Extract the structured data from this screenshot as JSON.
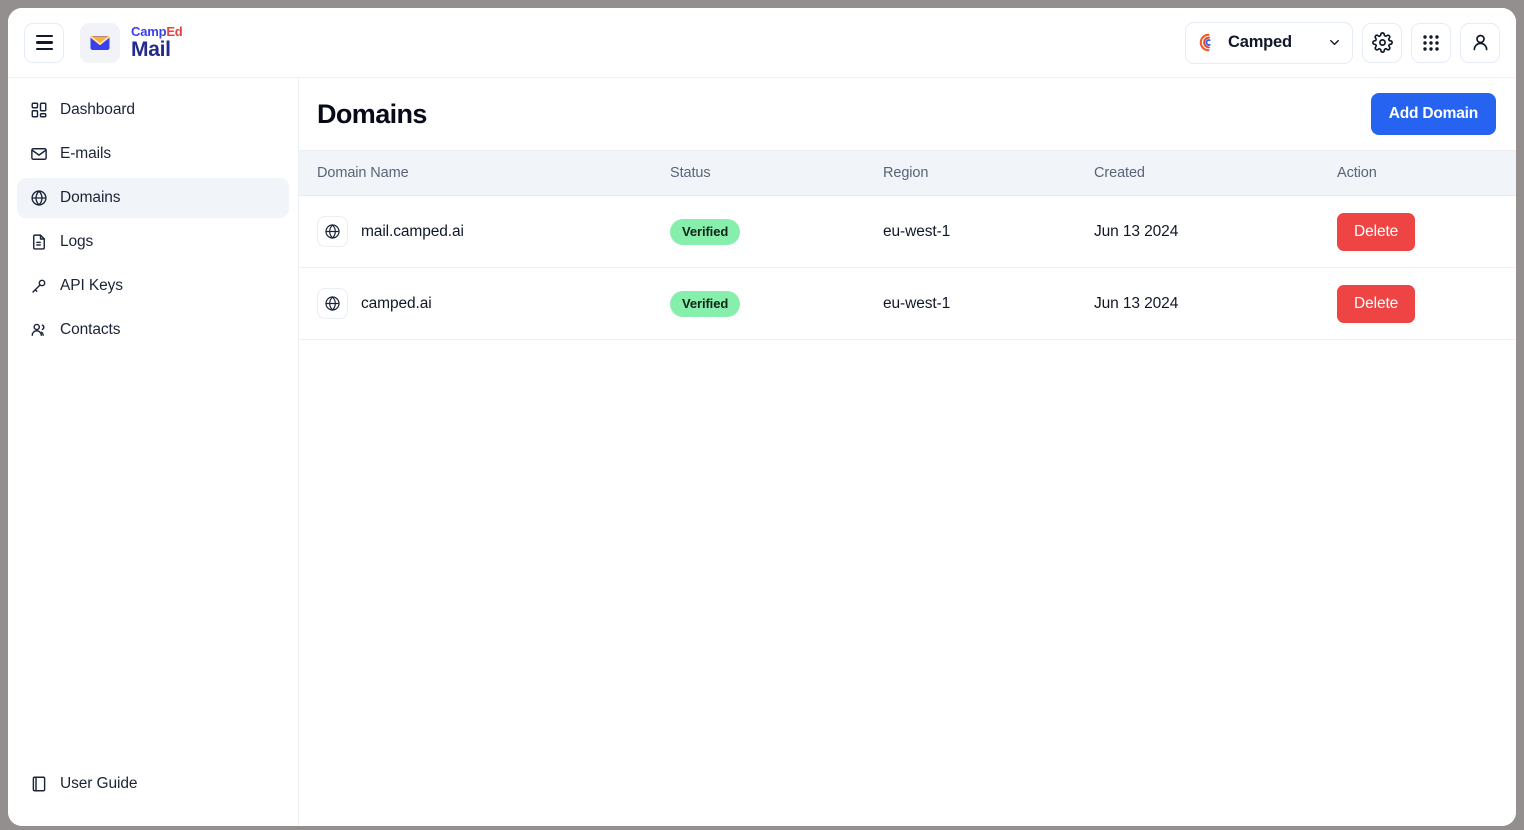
{
  "topbar": {
    "menu_icon": "hamburger-icon",
    "brand": {
      "line1_a": "Camp",
      "line1_b": "Ed",
      "line2": "Mail",
      "logo_icon": "envelope-icon"
    },
    "org_selector": {
      "logo_icon": "camped-logo-icon",
      "name": "Camped",
      "chevron_icon": "chevron-down-icon"
    },
    "settings_icon": "gear-icon",
    "apps_icon": "grid-apps-icon",
    "account_icon": "user-avatar-icon"
  },
  "sidebar": {
    "items": [
      {
        "label": "Dashboard",
        "icon": "dashboard-icon",
        "active": false
      },
      {
        "label": "E-mails",
        "icon": "mail-icon",
        "active": false
      },
      {
        "label": "Domains",
        "icon": "globe-icon",
        "active": true
      },
      {
        "label": "Logs",
        "icon": "document-icon",
        "active": false
      },
      {
        "label": "API Keys",
        "icon": "key-icon",
        "active": false
      },
      {
        "label": "Contacts",
        "icon": "users-icon",
        "active": false
      }
    ],
    "bottom": {
      "label": "User Guide",
      "icon": "book-icon"
    }
  },
  "main": {
    "title": "Domains",
    "add_button": "Add Domain",
    "table": {
      "columns": [
        "Domain Name",
        "Status",
        "Region",
        "Created",
        "Action"
      ],
      "rows": [
        {
          "icon": "globe-icon",
          "domain": "mail.camped.ai",
          "status": "Verified",
          "region": "eu-west-1",
          "created": "Jun 13 2024",
          "action": "Delete"
        },
        {
          "icon": "globe-icon",
          "domain": "camped.ai",
          "status": "Verified",
          "region": "eu-west-1",
          "created": "Jun 13 2024",
          "action": "Delete"
        }
      ]
    }
  },
  "colors": {
    "primary": "#2563f0",
    "danger": "#ef4444",
    "badge_verified_bg": "#86efac",
    "brand_blue": "#252a8e",
    "brand_red": "#e8413a"
  }
}
